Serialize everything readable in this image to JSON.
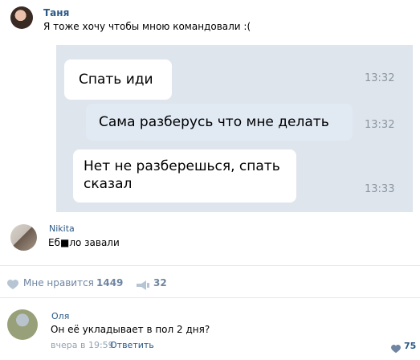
{
  "post": {
    "author": "Таня",
    "text": "Я тоже хочу чтобы мною командовали :("
  },
  "screenshot": {
    "messages": [
      {
        "text": "Спать иди",
        "time": "13:32"
      },
      {
        "text": "Сама разберусь что мне делать",
        "time": "13:32"
      },
      {
        "text": "Нет не разберешься, спать",
        "text2": "сказал",
        "time": "13:33"
      }
    ]
  },
  "reply": {
    "author": "Nikita",
    "text": "Еб■ло завали"
  },
  "actions": {
    "like_label": "Мне нравится",
    "like_count": "1449",
    "share_count": "32"
  },
  "comment": {
    "author": "Оля",
    "text": "Он её укладывает в пол 2 дня?",
    "time": "вчера в 19:59",
    "reply_label": "Ответить",
    "like_count": "75"
  },
  "colors": {
    "link": "#2a5885",
    "meta": "#93a3b5",
    "chat_bg": "#dfe5ec"
  }
}
